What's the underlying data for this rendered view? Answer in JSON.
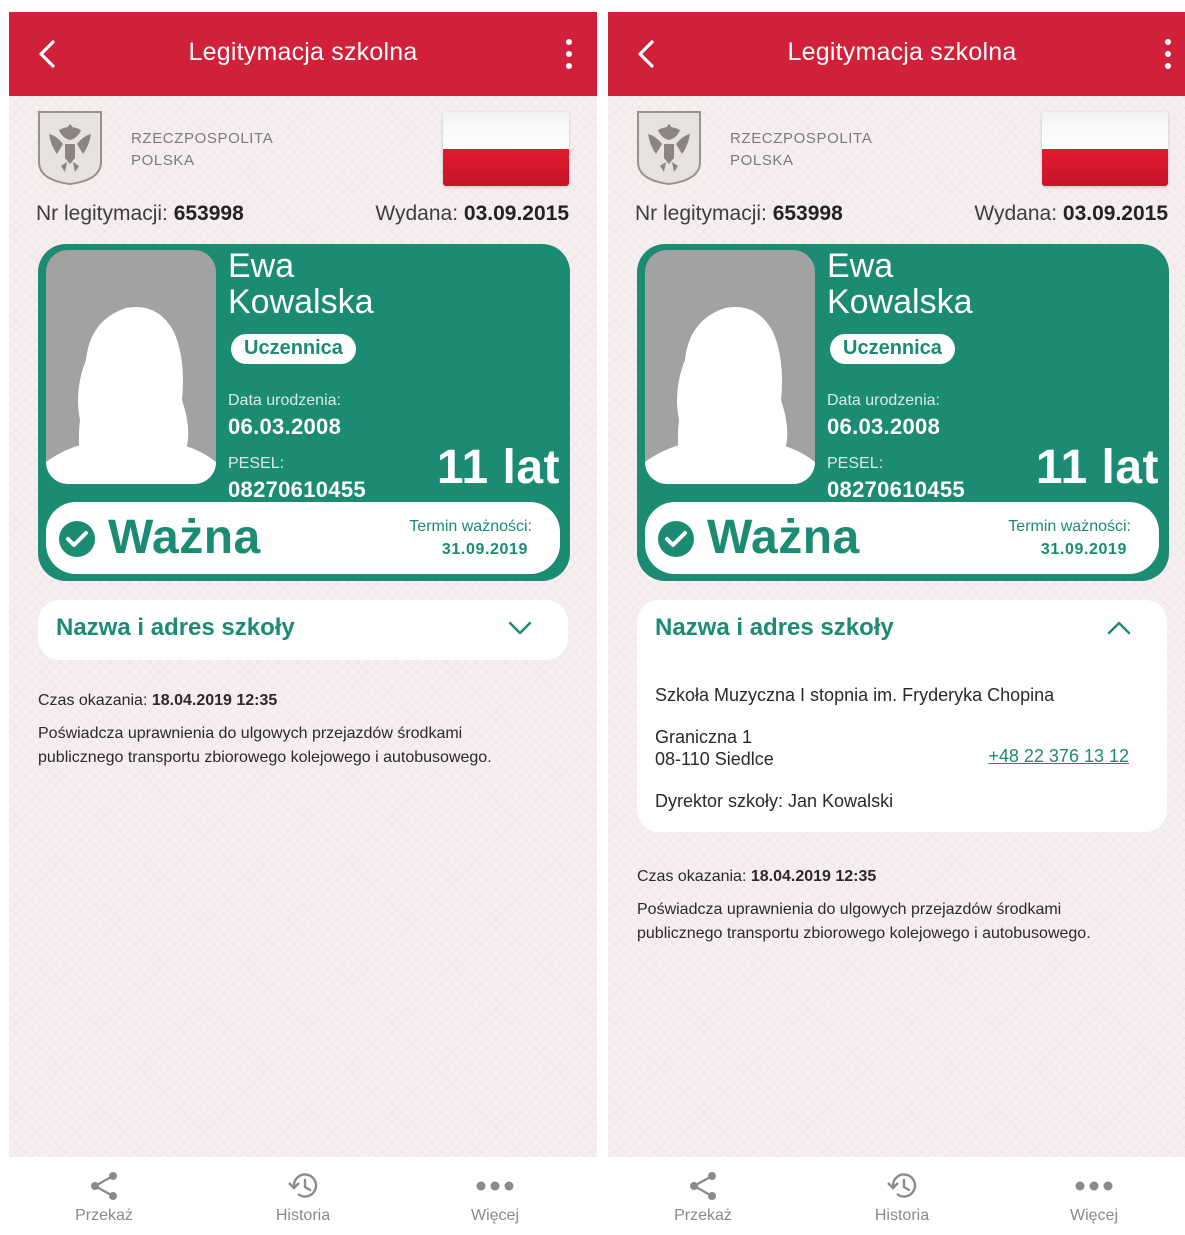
{
  "app": {
    "title": "Legitymacja szkolna",
    "back_icon": "chevron-left-icon",
    "menu_icon": "kebab-menu-icon",
    "accent_red": "#d0203a",
    "accent_green": "#1c8b73"
  },
  "header": {
    "emblem_icon": "polish-eagle-emblem",
    "republic_line1": "RZECZPOSPOLITA",
    "republic_line2": "POLSKA",
    "flag_icon": "polish-flag"
  },
  "document": {
    "number_label": "Nr legitymacji:",
    "number": "653998",
    "issued_label": "Wydana:",
    "issued": "03.09.2015"
  },
  "person": {
    "first_name": "Ewa",
    "last_name": "Kowalska",
    "status": "Uczennica",
    "birth_label": "Data urodzenia:",
    "birth_date": "06.03.2008",
    "pesel_label": "PESEL:",
    "pesel": "08270610455",
    "age": "11 lat",
    "photo_icon": "person-silhouette"
  },
  "validity": {
    "check_icon": "check-circle-icon",
    "status": "Ważna",
    "expiry_label": "Termin ważności:",
    "expiry_date": "31.09.2019"
  },
  "school": {
    "section_title": "Nazwa i adres szkoły",
    "name": "Szkoła Muzyczna I stopnia im. Fryderyka Chopina",
    "street": "Graniczna 1",
    "city": "08-110 Siedlce",
    "phone": "+48 22 376 13 12",
    "director": "Dyrektor szkoły: Jan Kowalski",
    "collapsed_icon": "chevron-down-icon",
    "expanded_icon": "chevron-up-icon"
  },
  "footer": {
    "shown_label": "Czas okazania:",
    "shown_time": "18.04.2019 12:35",
    "desc_line1": "Poświadcza uprawnienia do ulgowych przejazdów środkami",
    "desc_line2": "publicznego transportu zbiorowego kolejowego i autobusowego."
  },
  "nav": [
    {
      "label": "Przekaż",
      "icon": "share-icon"
    },
    {
      "label": "Historia",
      "icon": "history-icon"
    },
    {
      "label": "Więcej",
      "icon": "more-dots-icon"
    }
  ]
}
